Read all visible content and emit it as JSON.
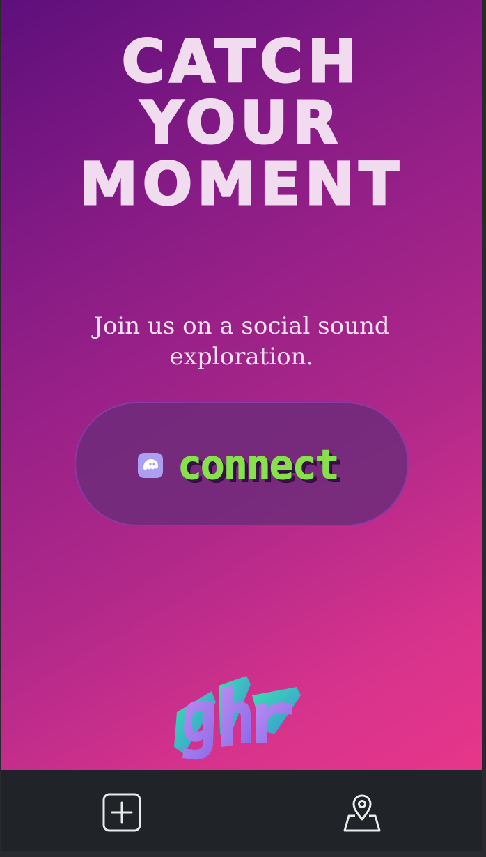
{
  "hero": {
    "headline_lines": [
      "CATCH",
      "YOUR",
      "MOMENT"
    ],
    "subtitle": "Join us on a social sound exploration."
  },
  "connect_button": {
    "label": "connect",
    "icon": "phantom-wallet-icon"
  },
  "logo": {
    "text": "ghr",
    "icon": "ghr-3d-logo"
  },
  "bottom_nav": {
    "items": [
      {
        "icon": "add-square-icon"
      },
      {
        "icon": "map-pin-icon"
      }
    ]
  },
  "colors": {
    "gradient_start": "#5e0f7c",
    "gradient_end": "#e6368a",
    "headline": "#f1dcef",
    "connect_text": "#86e14a",
    "button_bg": "#682c78",
    "phantom_icon": "#ab9ff2",
    "nav_bar": "#202327"
  }
}
